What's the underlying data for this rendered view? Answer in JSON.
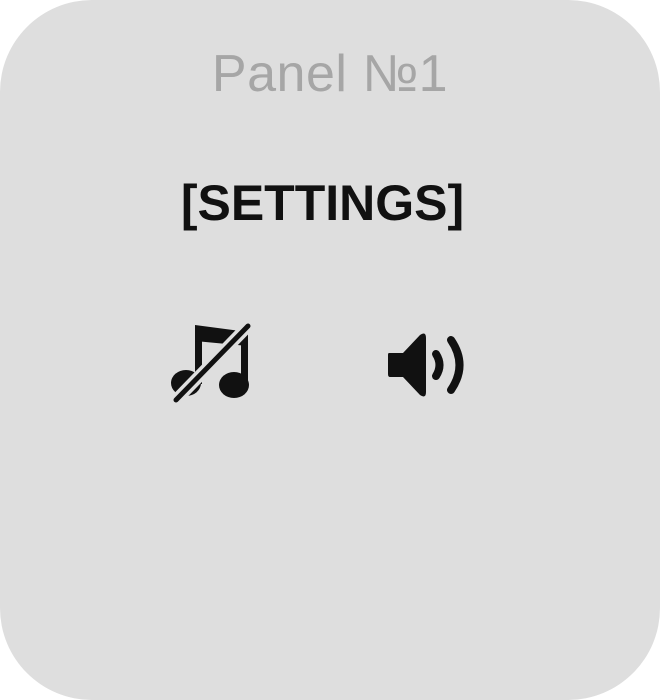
{
  "panel": {
    "title": "Panel №1",
    "heading": "[SETTINGS]"
  },
  "controls": {
    "music": {
      "icon": "music-off-icon",
      "state": "off"
    },
    "sound": {
      "icon": "volume-up-icon",
      "state": "on"
    }
  },
  "colors": {
    "panel_background": "#dedede",
    "title_text": "#a6a6a6",
    "heading_text": "#111111",
    "icon": "#111111"
  }
}
